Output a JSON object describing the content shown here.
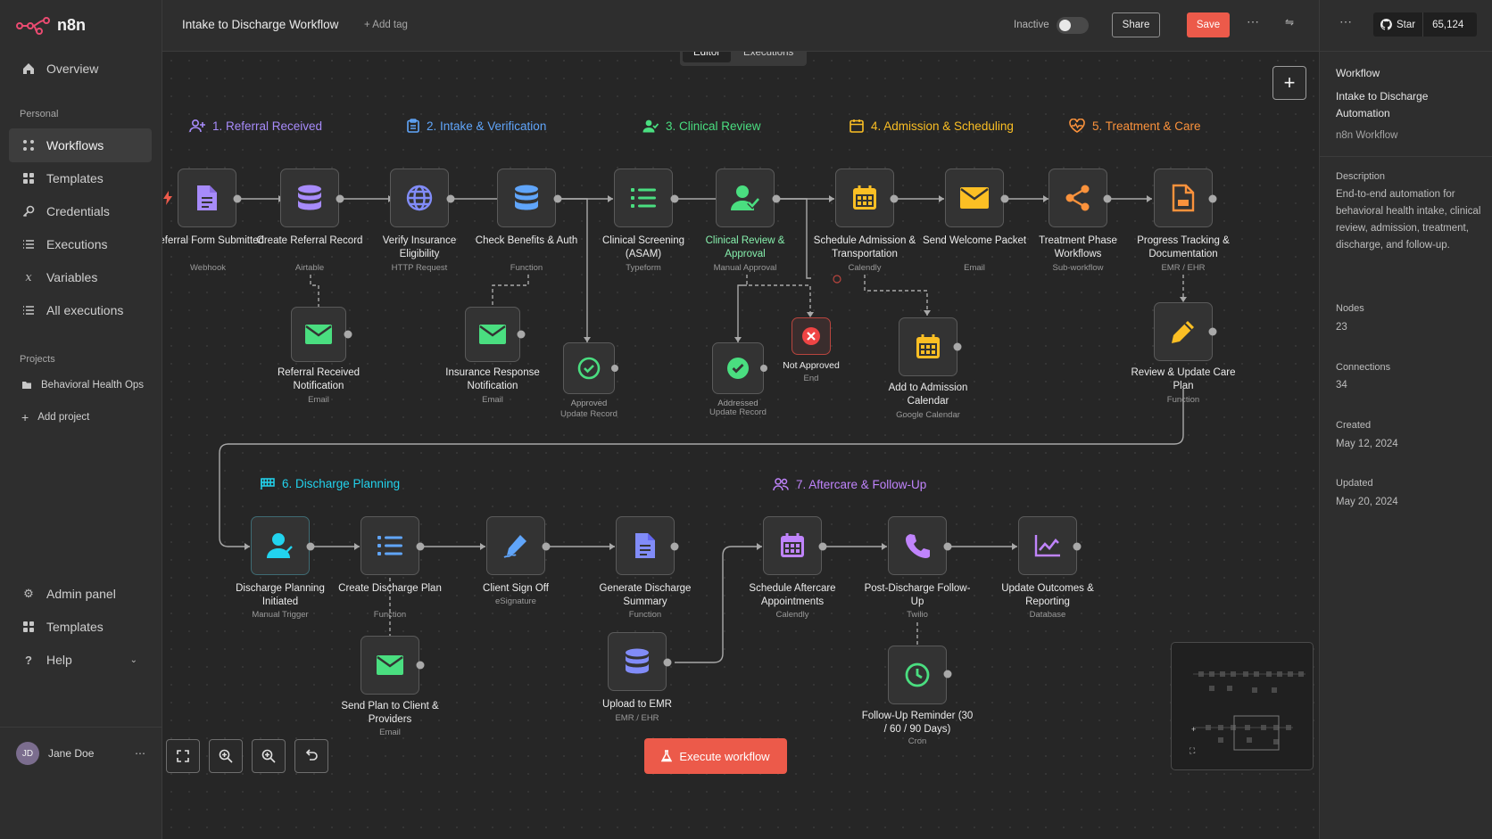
{
  "app": {
    "name": "n8n"
  },
  "sidebar": {
    "nav_top": [
      {
        "label": "Overview",
        "icon": "home-icon"
      }
    ],
    "personal_label": "Personal",
    "personal_items": [
      {
        "label": "Workflows",
        "icon": "workflow-icon",
        "active": true
      },
      {
        "label": "Templates",
        "icon": "templates-icon"
      },
      {
        "label": "Credentials",
        "icon": "key-icon"
      },
      {
        "label": "Executions",
        "icon": "list-icon"
      },
      {
        "label": "Variables",
        "icon": "variable-icon"
      },
      {
        "label": "All executions",
        "icon": "list-icon"
      }
    ],
    "projects_label": "Projects",
    "project_item": "Behavioral Health Ops",
    "add_project": "Add project",
    "bottom_items": [
      {
        "label": "Admin panel",
        "icon": "gear-icon"
      },
      {
        "label": "Templates",
        "icon": "templates-icon"
      },
      {
        "label": "Help",
        "icon": "help-icon"
      }
    ],
    "user": {
      "initials": "JD",
      "name": "Jane Doe"
    }
  },
  "topbar": {
    "title": "Intake to Discharge Workflow",
    "add_tag": "+ Add tag",
    "status_label": "Inactive",
    "share_label": "Share",
    "save_label": "Save",
    "star_label": "Star",
    "star_count": "65,124"
  },
  "tabs": {
    "editor": "Editor",
    "executions": "Executions"
  },
  "phases": [
    {
      "label": "1. Referral Received",
      "color": "#a78bfa",
      "icon": "user-plus-icon"
    },
    {
      "label": "2. Intake & Verification",
      "color": "#60a5fa",
      "icon": "clipboard-icon"
    },
    {
      "label": "3. Clinical Review",
      "color": "#4ade80",
      "icon": "user-check-icon"
    },
    {
      "label": "4. Admission & Scheduling",
      "color": "#fbbf24",
      "icon": "calendar-icon"
    },
    {
      "label": "5. Treatment & Care",
      "color": "#fb923c",
      "icon": "heart-pulse-icon"
    },
    {
      "label": "6. Discharge Planning",
      "color": "#22d3ee",
      "icon": "flag-icon"
    },
    {
      "label": "7. Aftercare & Follow-Up",
      "color": "#c084fc",
      "icon": "users-icon"
    }
  ],
  "nodes": [
    {
      "name": "Referral Form Submitted",
      "type": "Webhook",
      "icon": "document-icon",
      "color": "#a78bfa"
    },
    {
      "name": "Create Referral Record",
      "type": "Airtable",
      "icon": "database-icon",
      "color": "#a78bfa"
    },
    {
      "name": "Verify Insurance Eligibility",
      "type": "HTTP Request",
      "icon": "globe-icon",
      "color": "#60a5fa"
    },
    {
      "name": "Check Benefits & Auth",
      "type": "Function",
      "icon": "database-icon",
      "color": "#60a5fa"
    },
    {
      "name": "Clinical Screening (ASAM)",
      "type": "Typeform",
      "icon": "list-icon",
      "color": "#4ade80"
    },
    {
      "name": "Clinical Review & Approval",
      "type": "Manual Approval",
      "icon": "user-check-icon",
      "color": "#4ade80"
    },
    {
      "name": "Schedule Admission & Transportation",
      "type": "Calendly",
      "icon": "calendar-icon",
      "color": "#fbbf24"
    },
    {
      "name": "Send Welcome Packet",
      "type": "Email",
      "icon": "mail-icon",
      "color": "#fbbf24"
    },
    {
      "name": "Treatment Phase Workflows",
      "type": "Sub-workflow",
      "icon": "share-icon",
      "color": "#fb923c"
    },
    {
      "name": "Progress Tracking & Documentation",
      "type": "EMR / EHR",
      "icon": "document-icon",
      "color": "#fb923c"
    },
    {
      "name": "Referral Received Notification",
      "type": "Email",
      "icon": "mail-icon",
      "color": "#4ade80"
    },
    {
      "name": "Insurance Response Notification",
      "type": "Email",
      "icon": "mail-icon",
      "color": "#4ade80"
    },
    {
      "name": "Approved",
      "type": "Update Record",
      "icon": "check-circle-icon",
      "color": "#4ade80"
    },
    {
      "name": "Addressed",
      "type": "Update Record",
      "icon": "check-circle-icon",
      "color": "#4ade80"
    },
    {
      "name": "Not Approved",
      "type": "End",
      "icon": "x-circle-icon",
      "color": "#ef4444"
    },
    {
      "name": "Add to Admission Calendar",
      "type": "Google Calendar",
      "icon": "calendar-icon",
      "color": "#fbbf24"
    },
    {
      "name": "Review & Update Care Plan",
      "type": "Function",
      "icon": "pencil-icon",
      "color": "#fbbf24"
    },
    {
      "name": "Discharge Planning Initiated",
      "type": "Manual Trigger",
      "icon": "user-icon",
      "color": "#22d3ee"
    },
    {
      "name": "Create Discharge Plan",
      "type": "Function",
      "icon": "list-icon",
      "color": "#60a5fa"
    },
    {
      "name": "Client Sign Off",
      "type": "eSignature",
      "icon": "signature-icon",
      "color": "#60a5fa"
    },
    {
      "name": "Generate Discharge Summary",
      "type": "Function",
      "icon": "document-icon",
      "color": "#818cf8"
    },
    {
      "name": "Schedule Aftercare Appointments",
      "type": "Calendly",
      "icon": "calendar-icon",
      "color": "#c084fc"
    },
    {
      "name": "Post-Discharge Follow-Up",
      "type": "Twilio",
      "icon": "phone-icon",
      "color": "#c084fc"
    },
    {
      "name": "Update Outcomes & Reporting",
      "type": "Database",
      "icon": "chart-icon",
      "color": "#c084fc"
    },
    {
      "name": "Send Plan to Client & Providers",
      "type": "Email",
      "icon": "mail-icon",
      "color": "#4ade80"
    },
    {
      "name": "Upload to EMR",
      "type": "EMR / EHR",
      "icon": "database-icon",
      "color": "#818cf8"
    },
    {
      "name": "Follow-Up Reminder (30 / 60 / 90 Days)",
      "type": "Cron",
      "icon": "clock-icon",
      "color": "#4ade80"
    }
  ],
  "execute_label": "Execute workflow",
  "panel": {
    "workflow_label": "Workflow",
    "workflow_name": "Intake to Discharge Automation",
    "workflow_type": "n8n Workflow",
    "description_label": "Description",
    "description": "End-to-end automation for behavioral health intake, clinical review, admission, treatment, discharge, and follow-up.",
    "nodes_label": "Nodes",
    "nodes_value": "23",
    "connections_label": "Connections",
    "connections_value": "34",
    "created_label": "Created",
    "created_value": "May 12, 2024",
    "updated_label": "Updated",
    "updated_value": "May 20, 2024"
  }
}
